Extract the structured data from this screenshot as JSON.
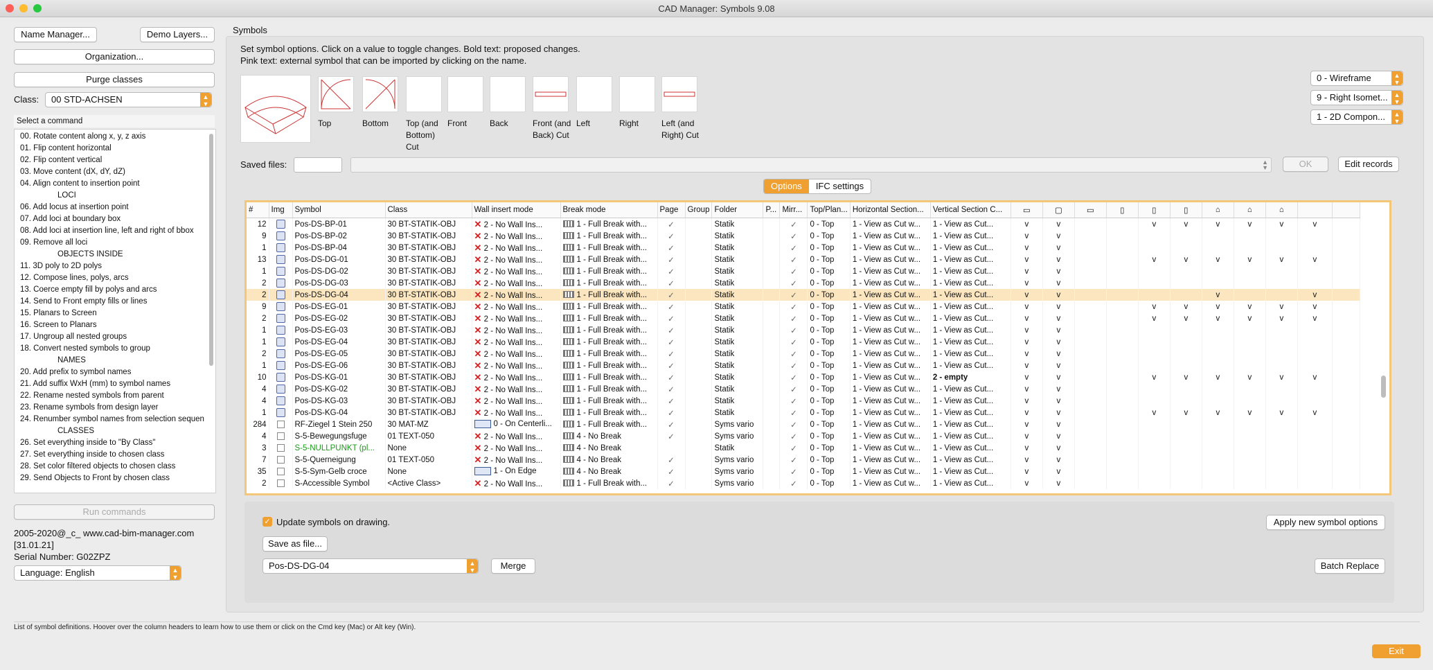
{
  "window": {
    "title": "CAD Manager: Symbols 9.08"
  },
  "left": {
    "name_manager": "Name Manager...",
    "demo_layers": "Demo Layers...",
    "organization": "Organization...",
    "purge_classes": "Purge classes",
    "class_label": "Class:",
    "class_value": "00 STD-ACHSEN",
    "select_command": "Select a command",
    "commands": [
      {
        "text": "00. Rotate content along x, y, z axis",
        "header": false
      },
      {
        "text": "01. Flip content horizontal",
        "header": false
      },
      {
        "text": "02. Flip content vertical",
        "header": false
      },
      {
        "text": "03. Move content (dX, dY, dZ)",
        "header": false
      },
      {
        "text": "04. Align content to insertion point",
        "header": false
      },
      {
        "text": "LOCI",
        "header": true
      },
      {
        "text": "06. Add locus at insertion point",
        "header": false
      },
      {
        "text": "07. Add loci at boundary box",
        "header": false
      },
      {
        "text": "08. Add loci at insertion line, left and right of bbox",
        "header": false
      },
      {
        "text": "09. Remove all loci",
        "header": false
      },
      {
        "text": "OBJECTS INSIDE",
        "header": true
      },
      {
        "text": "11. 3D poly to 2D polys",
        "header": false
      },
      {
        "text": "12. Compose lines, polys, arcs",
        "header": false
      },
      {
        "text": "13. Coerce empty fill by polys and arcs",
        "header": false
      },
      {
        "text": "14. Send to Front empty fills or lines",
        "header": false
      },
      {
        "text": "15. Planars to Screen",
        "header": false
      },
      {
        "text": "16. Screen to Planars",
        "header": false
      },
      {
        "text": "17. Ungroup all nested groups",
        "header": false
      },
      {
        "text": "18. Convert nested symbols to group",
        "header": false
      },
      {
        "text": "NAMES",
        "header": true
      },
      {
        "text": "20. Add prefix to symbol names",
        "header": false
      },
      {
        "text": "21. Add suffix WxH (mm) to symbol names",
        "header": false
      },
      {
        "text": "22. Rename nested symbols from parent",
        "header": false
      },
      {
        "text": "23. Rename symbols from design layer",
        "header": false
      },
      {
        "text": "24. Renumber symbol names from selection sequen",
        "header": false
      },
      {
        "text": "CLASSES",
        "header": true
      },
      {
        "text": "26. Set everything inside to \"By Class\"",
        "header": false
      },
      {
        "text": "27. Set everything inside to chosen class",
        "header": false
      },
      {
        "text": "28. Set color filtered objects to chosen class",
        "header": false
      },
      {
        "text": "29. Send Objects to Front by chosen class",
        "header": false
      }
    ],
    "run_commands": "Run commands",
    "copyright": "2005-2020@_c_ www.cad-bim-manager.com",
    "date": "[31.01.21]",
    "serial": "Serial Number: G02ZPZ",
    "language": "Language: English"
  },
  "symbols": {
    "group_label": "Symbols",
    "instructions_1": "Set symbol options. Click on a value to toggle changes. Bold text: proposed changes.",
    "instructions_2": "Pink text: external symbol that can be imported by clicking on the name.",
    "views": [
      "Top",
      "Bottom",
      "Top (and Bottom) Cut",
      "Front",
      "Back",
      "Front (and Back) Cut",
      "Left",
      "Right",
      "Left (and Right) Cut"
    ],
    "render_select": "0 - Wireframe",
    "view_select": "9 - Right Isomet...",
    "component_select": "1 - 2D Compon...",
    "saved_files_label": "Saved files:",
    "ok": "OK",
    "edit_records": "Edit records",
    "tab_options": "Options",
    "tab_ifc": "IFC settings"
  },
  "table": {
    "columns": [
      "#",
      "Img",
      "Symbol",
      "Class",
      "Wall insert mode",
      "Break mode",
      "Page",
      "Group",
      "Folder",
      "P...",
      "Mirr...",
      "Top/Plan...",
      "Horizontal Section...",
      "Vertical Section C..."
    ],
    "rows": [
      {
        "n": "12",
        "img": "sym",
        "symbol": "Pos-DS-BP-01",
        "cls": "30 BT-STATIK-OBJ",
        "wall": "2 - No Wall Ins...",
        "wicon": "x",
        "brk": "1 - Full Break with...",
        "page": "✓",
        "folder": "Statik",
        "mirr": "✓",
        "top": "0 - Top",
        "hs": "1 - View as Cut w...",
        "vs": "1 - View as Cut...",
        "vsb": false,
        "v": [
          "v",
          "v",
          "",
          "",
          "v",
          "v",
          "v",
          "v",
          "v",
          "v",
          ""
        ],
        "green": false,
        "hl": false
      },
      {
        "n": "9",
        "img": "sym",
        "symbol": "Pos-DS-BP-02",
        "cls": "30 BT-STATIK-OBJ",
        "wall": "2 - No Wall Ins...",
        "wicon": "x",
        "brk": "1 - Full Break with...",
        "page": "✓",
        "folder": "Statik",
        "mirr": "✓",
        "top": "0 - Top",
        "hs": "1 - View as Cut w...",
        "vs": "1 - View as Cut...",
        "vsb": false,
        "v": [
          "v",
          "v",
          "",
          "",
          "",
          "",
          "",
          "",
          "",
          "",
          ""
        ],
        "green": false,
        "hl": false
      },
      {
        "n": "1",
        "img": "sym",
        "symbol": "Pos-DS-BP-04",
        "cls": "30 BT-STATIK-OBJ",
        "wall": "2 - No Wall Ins...",
        "wicon": "x",
        "brk": "1 - Full Break with...",
        "page": "✓",
        "folder": "Statik",
        "mirr": "✓",
        "top": "0 - Top",
        "hs": "1 - View as Cut w...",
        "vs": "1 - View as Cut...",
        "vsb": false,
        "v": [
          "v",
          "v",
          "",
          "",
          "",
          "",
          "",
          "",
          "",
          "",
          ""
        ],
        "green": false,
        "hl": false
      },
      {
        "n": "13",
        "img": "sym",
        "symbol": "Pos-DS-DG-01",
        "cls": "30 BT-STATIK-OBJ",
        "wall": "2 - No Wall Ins...",
        "wicon": "x",
        "brk": "1 - Full Break with...",
        "page": "✓",
        "folder": "Statik",
        "mirr": "✓",
        "top": "0 - Top",
        "hs": "1 - View as Cut w...",
        "vs": "1 - View as Cut...",
        "vsb": false,
        "v": [
          "v",
          "v",
          "",
          "",
          "v",
          "v",
          "v",
          "v",
          "v",
          "v",
          ""
        ],
        "green": false,
        "hl": false
      },
      {
        "n": "1",
        "img": "sym",
        "symbol": "Pos-DS-DG-02",
        "cls": "30 BT-STATIK-OBJ",
        "wall": "2 - No Wall Ins...",
        "wicon": "x",
        "brk": "1 - Full Break with...",
        "page": "✓",
        "folder": "Statik",
        "mirr": "✓",
        "top": "0 - Top",
        "hs": "1 - View as Cut w...",
        "vs": "1 - View as Cut...",
        "vsb": false,
        "v": [
          "v",
          "v",
          "",
          "",
          "",
          "",
          "",
          "",
          "",
          "",
          ""
        ],
        "green": false,
        "hl": false
      },
      {
        "n": "2",
        "img": "sym",
        "symbol": "Pos-DS-DG-03",
        "cls": "30 BT-STATIK-OBJ",
        "wall": "2 - No Wall Ins...",
        "wicon": "x",
        "brk": "1 - Full Break with...",
        "page": "✓",
        "folder": "Statik",
        "mirr": "✓",
        "top": "0 - Top",
        "hs": "1 - View as Cut w...",
        "vs": "1 - View as Cut...",
        "vsb": false,
        "v": [
          "v",
          "v",
          "",
          "",
          "",
          "",
          "",
          "",
          "",
          "",
          ""
        ],
        "green": false,
        "hl": false
      },
      {
        "n": "2",
        "img": "sym",
        "symbol": "Pos-DS-DG-04",
        "cls": "30 BT-STATIK-OBJ",
        "wall": "2 - No Wall Ins...",
        "wicon": "x",
        "brk": "1 - Full Break with...",
        "page": "✓",
        "folder": "Statik",
        "mirr": "✓",
        "top": "0 - Top",
        "hs": "1 - View as Cut w...",
        "vs": "1 - View as Cut...",
        "vsb": false,
        "v": [
          "v",
          "v",
          "",
          "",
          "",
          "",
          "v",
          "",
          "",
          "v",
          ""
        ],
        "green": false,
        "hl": true
      },
      {
        "n": "9",
        "img": "sym",
        "symbol": "Pos-DS-EG-01",
        "cls": "30 BT-STATIK-OBJ",
        "wall": "2 - No Wall Ins...",
        "wicon": "x",
        "brk": "1 - Full Break with...",
        "page": "✓",
        "folder": "Statik",
        "mirr": "✓",
        "top": "0 - Top",
        "hs": "1 - View as Cut w...",
        "vs": "1 - View as Cut...",
        "vsb": false,
        "v": [
          "v",
          "v",
          "",
          "",
          "v",
          "v",
          "v",
          "v",
          "v",
          "v",
          ""
        ],
        "green": false,
        "hl": false
      },
      {
        "n": "2",
        "img": "sym",
        "symbol": "Pos-DS-EG-02",
        "cls": "30 BT-STATIK-OBJ",
        "wall": "2 - No Wall Ins...",
        "wicon": "x",
        "brk": "1 - Full Break with...",
        "page": "✓",
        "folder": "Statik",
        "mirr": "✓",
        "top": "0 - Top",
        "hs": "1 - View as Cut w...",
        "vs": "1 - View as Cut...",
        "vsb": false,
        "v": [
          "v",
          "v",
          "",
          "",
          "v",
          "v",
          "v",
          "v",
          "v",
          "v",
          ""
        ],
        "green": false,
        "hl": false
      },
      {
        "n": "1",
        "img": "sym",
        "symbol": "Pos-DS-EG-03",
        "cls": "30 BT-STATIK-OBJ",
        "wall": "2 - No Wall Ins...",
        "wicon": "x",
        "brk": "1 - Full Break with...",
        "page": "✓",
        "folder": "Statik",
        "mirr": "✓",
        "top": "0 - Top",
        "hs": "1 - View as Cut w...",
        "vs": "1 - View as Cut...",
        "vsb": false,
        "v": [
          "v",
          "v",
          "",
          "",
          "",
          "",
          "",
          "",
          "",
          "",
          ""
        ],
        "green": false,
        "hl": false
      },
      {
        "n": "1",
        "img": "sym",
        "symbol": "Pos-DS-EG-04",
        "cls": "30 BT-STATIK-OBJ",
        "wall": "2 - No Wall Ins...",
        "wicon": "x",
        "brk": "1 - Full Break with...",
        "page": "✓",
        "folder": "Statik",
        "mirr": "✓",
        "top": "0 - Top",
        "hs": "1 - View as Cut w...",
        "vs": "1 - View as Cut...",
        "vsb": false,
        "v": [
          "v",
          "v",
          "",
          "",
          "",
          "",
          "",
          "",
          "",
          "",
          ""
        ],
        "green": false,
        "hl": false
      },
      {
        "n": "2",
        "img": "sym",
        "symbol": "Pos-DS-EG-05",
        "cls": "30 BT-STATIK-OBJ",
        "wall": "2 - No Wall Ins...",
        "wicon": "x",
        "brk": "1 - Full Break with...",
        "page": "✓",
        "folder": "Statik",
        "mirr": "✓",
        "top": "0 - Top",
        "hs": "1 - View as Cut w...",
        "vs": "1 - View as Cut...",
        "vsb": false,
        "v": [
          "v",
          "v",
          "",
          "",
          "",
          "",
          "",
          "",
          "",
          "",
          ""
        ],
        "green": false,
        "hl": false
      },
      {
        "n": "1",
        "img": "sym",
        "symbol": "Pos-DS-EG-06",
        "cls": "30 BT-STATIK-OBJ",
        "wall": "2 - No Wall Ins...",
        "wicon": "x",
        "brk": "1 - Full Break with...",
        "page": "✓",
        "folder": "Statik",
        "mirr": "✓",
        "top": "0 - Top",
        "hs": "1 - View as Cut w...",
        "vs": "1 - View as Cut...",
        "vsb": false,
        "v": [
          "v",
          "v",
          "",
          "",
          "",
          "",
          "",
          "",
          "",
          "",
          ""
        ],
        "green": false,
        "hl": false
      },
      {
        "n": "10",
        "img": "sym",
        "symbol": "Pos-DS-KG-01",
        "cls": "30 BT-STATIK-OBJ",
        "wall": "2 - No Wall Ins...",
        "wicon": "x",
        "brk": "1 - Full Break with...",
        "page": "✓",
        "folder": "Statik",
        "mirr": "✓",
        "top": "0 - Top",
        "hs": "1 - View as Cut w...",
        "vs": "2 - empty",
        "vsb": true,
        "v": [
          "v",
          "v",
          "",
          "",
          "v",
          "v",
          "v",
          "v",
          "v",
          "v",
          ""
        ],
        "green": false,
        "hl": false
      },
      {
        "n": "4",
        "img": "sym",
        "symbol": "Pos-DS-KG-02",
        "cls": "30 BT-STATIK-OBJ",
        "wall": "2 - No Wall Ins...",
        "wicon": "x",
        "brk": "1 - Full Break with...",
        "page": "✓",
        "folder": "Statik",
        "mirr": "✓",
        "top": "0 - Top",
        "hs": "1 - View as Cut w...",
        "vs": "1 - View as Cut...",
        "vsb": false,
        "v": [
          "v",
          "v",
          "",
          "",
          "",
          "",
          "",
          "",
          "",
          "",
          ""
        ],
        "green": false,
        "hl": false
      },
      {
        "n": "4",
        "img": "sym",
        "symbol": "Pos-DS-KG-03",
        "cls": "30 BT-STATIK-OBJ",
        "wall": "2 - No Wall Ins...",
        "wicon": "x",
        "brk": "1 - Full Break with...",
        "page": "✓",
        "folder": "Statik",
        "mirr": "✓",
        "top": "0 - Top",
        "hs": "1 - View as Cut w...",
        "vs": "1 - View as Cut...",
        "vsb": false,
        "v": [
          "v",
          "v",
          "",
          "",
          "",
          "",
          "",
          "",
          "",
          "",
          ""
        ],
        "green": false,
        "hl": false
      },
      {
        "n": "1",
        "img": "sym",
        "symbol": "Pos-DS-KG-04",
        "cls": "30 BT-STATIK-OBJ",
        "wall": "2 - No Wall Ins...",
        "wicon": "x",
        "brk": "1 - Full Break with...",
        "page": "✓",
        "folder": "Statik",
        "mirr": "✓",
        "top": "0 - Top",
        "hs": "1 - View as Cut w...",
        "vs": "1 - View as Cut...",
        "vsb": false,
        "v": [
          "v",
          "v",
          "",
          "",
          "v",
          "v",
          "v",
          "v",
          "v",
          "v",
          ""
        ],
        "green": false,
        "hl": false
      },
      {
        "n": "284",
        "img": "plain",
        "symbol": "RF-Ziegel 1 Stein 250",
        "cls": "30 MAT-MZ",
        "wall": "0 - On Centerli...",
        "wicon": "wall",
        "brk": "1 - Full Break with...",
        "page": "✓",
        "folder": "Syms vario",
        "mirr": "✓",
        "top": "0 - Top",
        "hs": "1 - View as Cut w...",
        "vs": "1 - View as Cut...",
        "vsb": false,
        "v": [
          "v",
          "v",
          "",
          "",
          "",
          "",
          "",
          "",
          "",
          "",
          ""
        ],
        "green": false,
        "hl": false
      },
      {
        "n": "4",
        "img": "plain",
        "symbol": "S-5-Bewegungsfuge",
        "cls": "01 TEXT-050",
        "wall": "2 - No Wall Ins...",
        "wicon": "x",
        "brk": "4 - No Break",
        "page": "✓",
        "folder": "Syms vario",
        "mirr": "✓",
        "top": "0 - Top",
        "hs": "1 - View as Cut w...",
        "vs": "1 - View as Cut...",
        "vsb": false,
        "v": [
          "v",
          "v",
          "",
          "",
          "",
          "",
          "",
          "",
          "",
          "",
          ""
        ],
        "green": false,
        "hl": false
      },
      {
        "n": "3",
        "img": "plain",
        "symbol": "S-5-NULLPUNKT (pl...",
        "cls": "None",
        "wall": "2 - No Wall Ins...",
        "wicon": "x",
        "brk": "4 - No Break",
        "page": "",
        "folder": "Statik",
        "mirr": "✓",
        "top": "0 - Top",
        "hs": "1 - View as Cut w...",
        "vs": "1 - View as Cut...",
        "vsb": false,
        "v": [
          "v",
          "v",
          "",
          "",
          "",
          "",
          "",
          "",
          "",
          "",
          ""
        ],
        "green": true,
        "hl": false
      },
      {
        "n": "7",
        "img": "plain",
        "symbol": "S-5-Querneigung",
        "cls": "01 TEXT-050",
        "wall": "2 - No Wall Ins...",
        "wicon": "x",
        "brk": "4 - No Break",
        "page": "✓",
        "folder": "Syms vario",
        "mirr": "✓",
        "top": "0 - Top",
        "hs": "1 - View as Cut w...",
        "vs": "1 - View as Cut...",
        "vsb": false,
        "v": [
          "v",
          "v",
          "",
          "",
          "",
          "",
          "",
          "",
          "",
          "",
          ""
        ],
        "green": false,
        "hl": false
      },
      {
        "n": "35",
        "img": "plain",
        "symbol": "S-5-Sym-Gelb croce",
        "cls": "None",
        "wall": "1 - On Edge",
        "wicon": "wall",
        "brk": "4 - No Break",
        "page": "✓",
        "folder": "Syms vario",
        "mirr": "✓",
        "top": "0 - Top",
        "hs": "1 - View as Cut w...",
        "vs": "1 - View as Cut...",
        "vsb": false,
        "v": [
          "v",
          "v",
          "",
          "",
          "",
          "",
          "",
          "",
          "",
          "",
          ""
        ],
        "green": false,
        "hl": false
      },
      {
        "n": "2",
        "img": "plain",
        "symbol": "S-Accessible Symbol",
        "cls": "<Active Class>",
        "wall": "2 - No Wall Ins...",
        "wicon": "x",
        "brk": "1 - Full Break with...",
        "page": "✓",
        "folder": "Syms vario",
        "mirr": "✓",
        "top": "0 - Top",
        "hs": "1 - View as Cut w...",
        "vs": "1 - View as Cut...",
        "vsb": false,
        "v": [
          "v",
          "v",
          "",
          "",
          "",
          "",
          "",
          "",
          "",
          "",
          ""
        ],
        "green": false,
        "hl": false
      }
    ]
  },
  "bottom": {
    "update_label": "Update symbols on drawing.",
    "update_checked": true,
    "save_as_file": "Save as file...",
    "apply_options": "Apply new symbol options",
    "symbol_select": "Pos-DS-DG-04",
    "merge": "Merge",
    "batch_replace": "Batch Replace",
    "status": "List of symbol definitions. Hoover over the column headers to learn how to use them or click on the Cmd key (Mac) or Alt key (Win).",
    "exit": "Exit"
  },
  "colors": {
    "accent": "#f0a030",
    "highlight": "#fbe6bf",
    "green_text": "#1a9a1a",
    "red_x": "#d42020"
  }
}
